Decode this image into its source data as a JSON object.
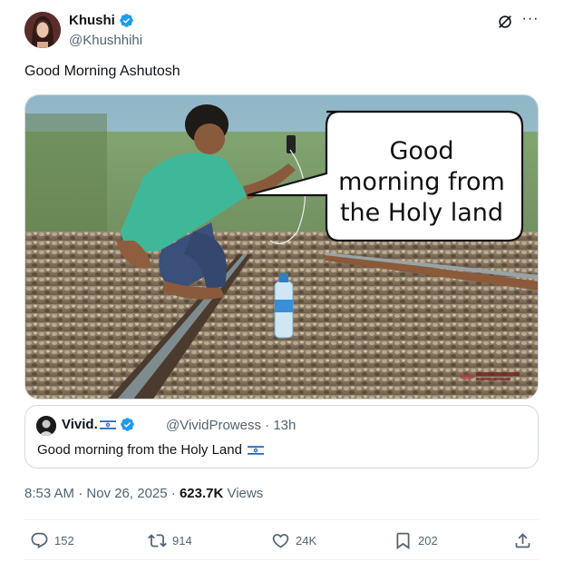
{
  "author": {
    "name": "Khushi",
    "handle": "@Khushhihi"
  },
  "tweet": {
    "text": "Good Morning Ashutosh",
    "image_caption": "Good morning from the Holy land",
    "bubble_lines": [
      "Good",
      "morning from",
      "the Holy land"
    ]
  },
  "quote": {
    "name": "Vivid.",
    "handle": "@VividProwess",
    "time": "· 13h",
    "text": "Good morning from the Holy Land"
  },
  "meta": {
    "timestamp": "8:53 AM · Nov 26, 2025 ·",
    "views_count": "623.7K",
    "views_label": "Views"
  },
  "actions": {
    "replies": "152",
    "reposts": "914",
    "likes": "24K",
    "bookmarks": "202"
  },
  "icons": {
    "verified": "verified-badge-icon",
    "grok": "grok-icon",
    "more": "more-icon",
    "reply": "reply-icon",
    "repost": "repost-icon",
    "like": "heart-icon",
    "bookmark": "bookmark-icon",
    "share": "share-icon"
  },
  "colors": {
    "verified": "#1d9bf0",
    "muted": "#536471",
    "text": "#0f1419",
    "border": "#cfd9de"
  }
}
